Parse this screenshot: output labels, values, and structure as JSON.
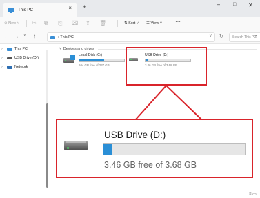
{
  "window": {
    "tab_title": "This PC",
    "tab_close": "×",
    "new_tab": "+",
    "minimize": "–",
    "maximize": "□",
    "close": "✕"
  },
  "command_bar": {
    "new_label": "⊕ New ˅",
    "cut": "✂",
    "copy": "⧉",
    "paste": "⎘",
    "rename": "⌧",
    "share": "⇪",
    "delete": "🗑",
    "sort_label": "⇅ Sort ˅",
    "view_label": "☰ View ˅",
    "more": "···"
  },
  "address_bar": {
    "back": "←",
    "forward": "→",
    "recent": "˅",
    "up": "↑",
    "path": "› This PC",
    "dropdown": "˅",
    "refresh": "↻",
    "search_placeholder": "Search This PC",
    "search_icon": "⌕"
  },
  "nav_pane": {
    "items": [
      {
        "chevron": "›",
        "label": "This PC",
        "icon": "pc-icon"
      },
      {
        "chevron": "›",
        "label": "USB Drive (D:)",
        "icon": "usb-drive-icon"
      },
      {
        "chevron": "›",
        "label": "Network",
        "icon": "network-icon"
      }
    ]
  },
  "content": {
    "group_chevron": "˅",
    "group_label": "Devices and drives",
    "drives": [
      {
        "name": "Local Disk (C:)",
        "free_text": "104 GB free of 237 GB",
        "used_fraction": 0.56
      },
      {
        "name": "USB Drive (D:)",
        "free_text": "3.46 GB free of 3.68 GB",
        "used_fraction": 0.06
      }
    ]
  },
  "callout": {
    "name": "USB Drive (D:)",
    "free_text": "3.46 GB free of 3.68 GB",
    "used_fraction": 0.06
  },
  "colors": {
    "accent": "#2b8fd6",
    "callout_red": "#d9242b"
  },
  "status_bar": {
    "view_icons": "≡ ▭"
  }
}
